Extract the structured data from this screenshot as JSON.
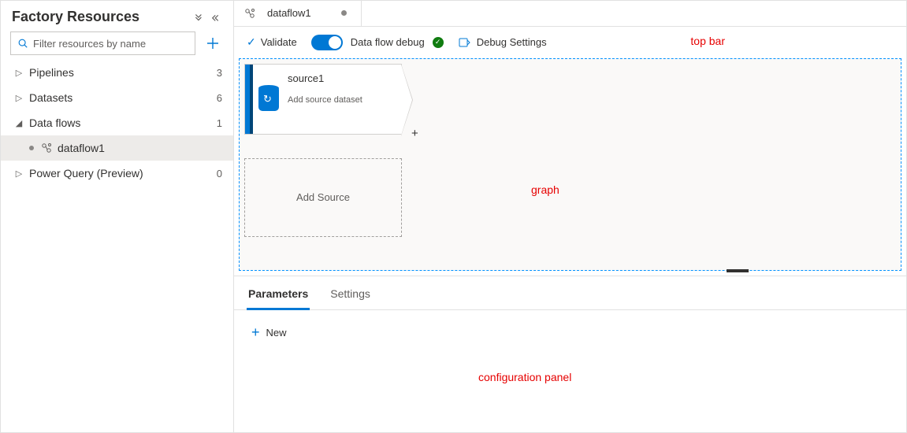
{
  "sidebar": {
    "title": "Factory Resources",
    "filter_placeholder": "Filter resources by name",
    "items": [
      {
        "label": "Pipelines",
        "count": "3",
        "expanded": false
      },
      {
        "label": "Datasets",
        "count": "6",
        "expanded": false
      },
      {
        "label": "Data flows",
        "count": "1",
        "expanded": true,
        "children": [
          {
            "label": "dataflow1"
          }
        ]
      },
      {
        "label": "Power Query (Preview)",
        "count": "0",
        "expanded": false
      }
    ]
  },
  "tab": {
    "label": "dataflow1"
  },
  "toolbar": {
    "validate_label": "Validate",
    "debug_toggle_label": "Data flow debug",
    "debug_settings_label": "Debug Settings"
  },
  "graph": {
    "node_name": "source1",
    "node_subtitle": "Add source dataset",
    "add_source_label": "Add Source"
  },
  "config": {
    "tabs": [
      "Parameters",
      "Settings"
    ],
    "active_tab": "Parameters",
    "new_label": "New"
  },
  "annotations": {
    "topbar": "top bar",
    "graph": "graph",
    "config": "configuration panel"
  },
  "icons": {
    "search": "search-icon",
    "plus": "plus-icon",
    "dataflow": "dataflow-icon"
  }
}
